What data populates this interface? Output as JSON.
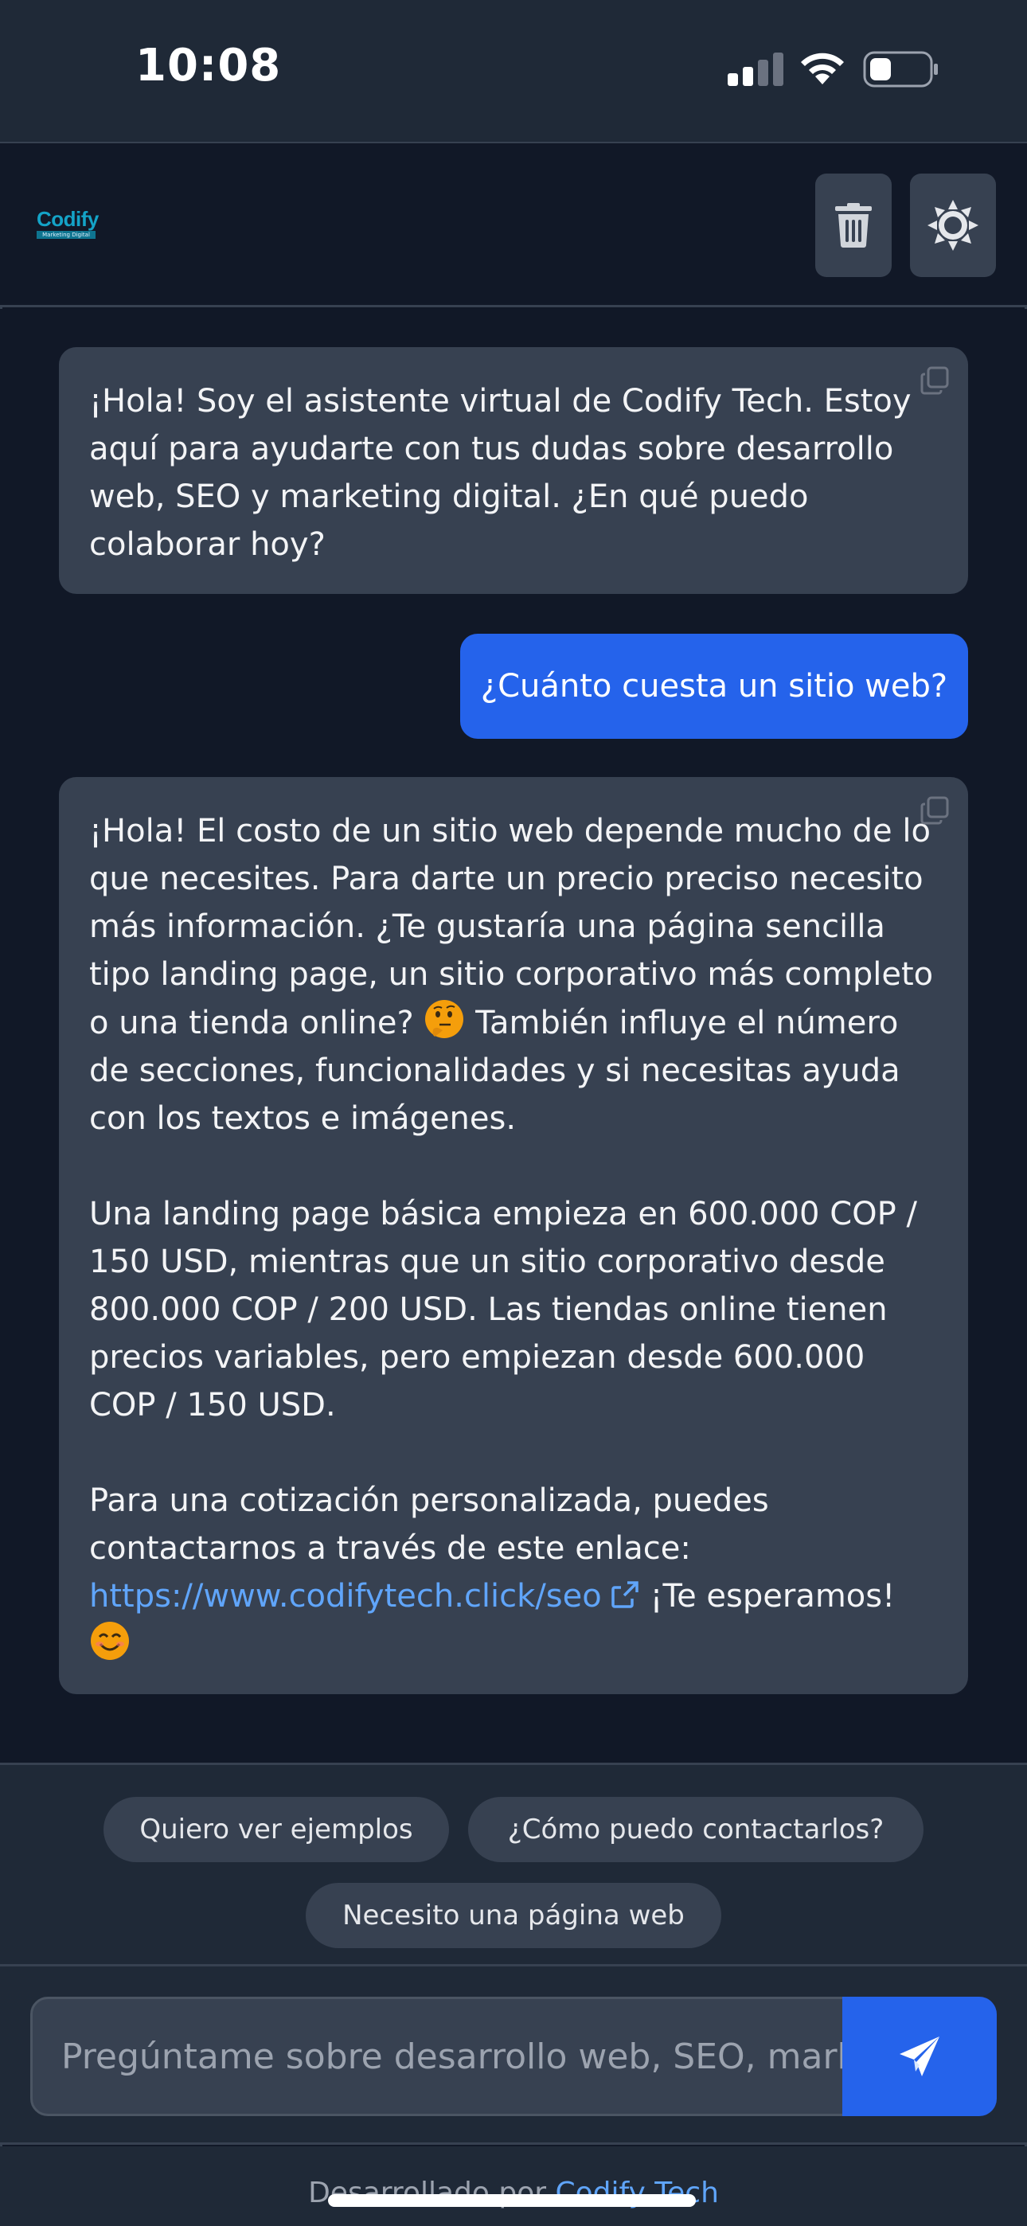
{
  "status_bar": {
    "time": "10:08"
  },
  "header": {
    "logo_text": "Codify",
    "logo_subtext": "Marketing Digital"
  },
  "messages": [
    {
      "role": "assistant",
      "paragraphs": [
        "¡Hola! Soy el asistente virtual de Codify Tech. Estoy aquí para ayudarte con tus dudas sobre desarrollo web, SEO y marketing digital. ¿En qué puedo colaborar hoy?"
      ]
    },
    {
      "role": "user",
      "text": "¿Cuánto cuesta un sitio web?"
    },
    {
      "role": "assistant",
      "p1_part1": "¡Hola! El costo de un sitio web depende mucho de lo que necesites. Para darte un precio preciso necesito más información. ¿Te gustaría una página sencilla tipo landing page, un sitio corporativo más completo o una tienda online?",
      "p1_part2": "También influye el número de secciones, funcionalidades y si necesitas ayuda con los textos e imágenes.",
      "p2": "Una landing page básica empieza en 600.000 COP / 150 USD, mientras que un sitio corporativo desde 800.000 COP / 200 USD. Las tiendas online tienen precios variables, pero empiezan desde 600.000 COP / 150 USD.",
      "p3_text": "Para una cotización personalizada, puedes contactarnos a través de este enlace:",
      "p3_link": "https://www.codifytech.click/seo",
      "p3_after": "¡Te esperamos!"
    }
  ],
  "suggestions": [
    "Quiero ver ejemplos",
    "¿Cómo puedo contactarlos?",
    "Necesito una página web"
  ],
  "input": {
    "placeholder": "Pregúntame sobre desarrollo web, SEO, marketing digital..."
  },
  "footer": {
    "prefix": "Desarrollado por",
    "brand": "Codify Tech"
  },
  "colors": {
    "background": "#111827",
    "panel": "#1f2937",
    "bubble_bot": "#374151",
    "accent": "#2563eb",
    "link": "#60a5fa"
  }
}
